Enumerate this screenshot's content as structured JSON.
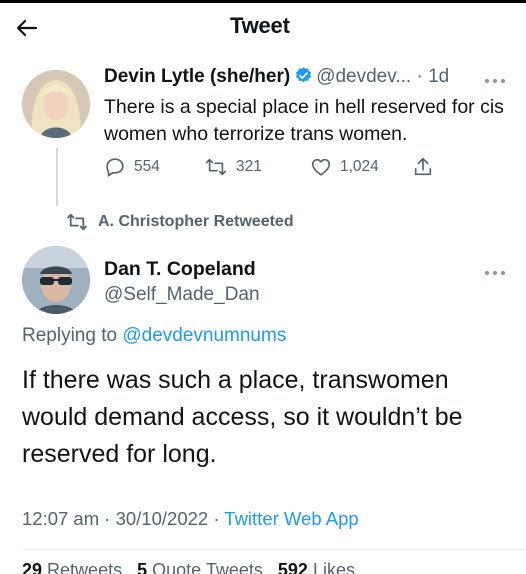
{
  "header": {
    "title": "Tweet"
  },
  "quoted_tweet": {
    "author_name": "Devin Lytle (she/her)",
    "handle": "@devdev...",
    "separator": " · ",
    "time": "1d",
    "text": "There is a special place in hell reserved for cis women who terrorize trans women.",
    "replies": "554",
    "retweets": "321",
    "likes": "1,024"
  },
  "retweet_notice": {
    "text": "A. Christopher Retweeted"
  },
  "main_tweet": {
    "author_name": "Dan T. Copeland",
    "handle": "@Self_Made_Dan",
    "replying_prefix": "Replying to ",
    "replying_to": "@devdevnumnums",
    "text": "If there was such a place, transwomen would demand access, so it wouldn’t be reserved for long.",
    "time": "12:07 am",
    "separator": " · ",
    "date": "30/10/2022",
    "source": "Twitter Web App"
  },
  "stats": {
    "retweets_count": "29",
    "retweets_label": "Retweets",
    "quote_count": "5",
    "quote_label": "Quote Tweets",
    "likes_count": "592",
    "likes_label": "Likes"
  },
  "colors": {
    "accent": "#1d9bf0",
    "muted": "#536471",
    "text": "#0f1419"
  },
  "icons": [
    "back-arrow-icon",
    "verified-badge-icon",
    "more-icon",
    "reply-icon",
    "retweet-icon",
    "like-icon",
    "share-icon"
  ]
}
